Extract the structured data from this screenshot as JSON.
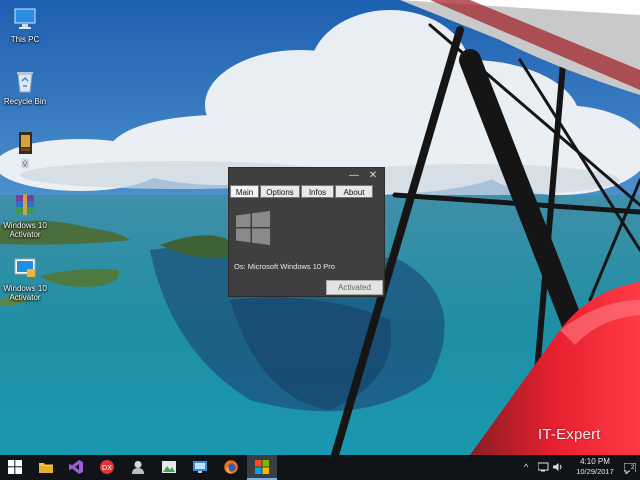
{
  "desktop": {
    "icons": [
      {
        "label": "This PC",
        "icon": "computer-icon"
      },
      {
        "label": "Recycle Bin",
        "icon": "recycle-bin-icon"
      },
      {
        "label": "X",
        "icon": "file-icon"
      },
      {
        "label": "Windows 10 Activator",
        "icon": "winrar-archive-icon"
      },
      {
        "label": "Windows 10 Activator",
        "icon": "activator-app-icon"
      }
    ]
  },
  "app": {
    "min_glyph": "—",
    "close_glyph": "✕",
    "tabs": [
      "Main",
      "Options",
      "Infos",
      "About"
    ],
    "os_text": "Os: Microsoft Windows 10 Pro",
    "status_button": "Activated",
    "colors": {
      "window_bg": "#3f3f3f",
      "logo": "#8a8a8a",
      "tab_bg": "#e9e9e9"
    }
  },
  "watermark": "IT-Expert",
  "taskbar": {
    "pinned": [
      "start-icon",
      "file-explorer-icon",
      "visual-studio-icon",
      "devexpress-icon",
      "user-accounts-icon",
      "image-editor-icon",
      "remote-desktop-icon",
      "firefox-icon",
      "activator-taskbar-icon"
    ],
    "tray": {
      "chevron": "^",
      "time": "4:10 PM",
      "date": "10/29/2017",
      "notification_count": "2"
    }
  }
}
